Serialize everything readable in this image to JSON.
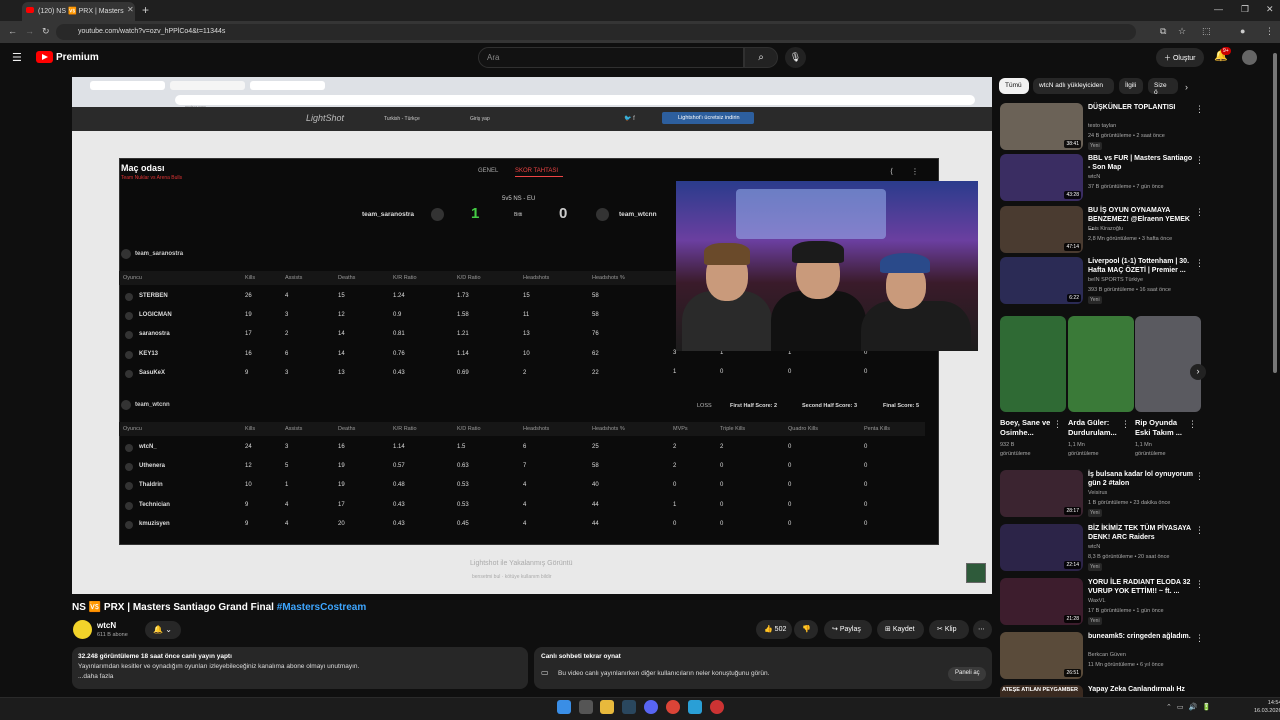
{
  "browser": {
    "tab_title": "(120) NS 🆚 PRX | Masters",
    "url": "youtube.com/watch?v=ozv_hPPlCo4&t=11344s"
  },
  "youtube": {
    "brand": "Premium",
    "search_placeholder": "Ara",
    "create_label": "Oluştur",
    "notif_count": "9+"
  },
  "player": {
    "inner_url": "prntscr.com",
    "lightshot_logo": "LightShot",
    "lightshot_lang": "Turkish - Türkçe",
    "lightshot_login": "Giriş yap",
    "lightshot_download": "Lightshot'ı ücretsiz indirin",
    "caption": "Lightshot ile Yakalanmış Görüntü",
    "caption_sub": "bensetmi bul  ·  kötüye kullanım bildir"
  },
  "scoreboard": {
    "title": "Maç odası",
    "subtitle": "Team Nuklar vs Arena Bulls",
    "tab_general": "GENEL",
    "tab_score": "SKOR TAHTASI",
    "mode": "5v5 NS - EU",
    "team1": "team_saranostra",
    "score1": "1",
    "status": "Bitti",
    "score2": "0",
    "team2": "team_wtcnn",
    "section1": "team_saranostra",
    "section2": "team_wtcnn",
    "loss": "LOSS",
    "first_half": "First Half Score: 2",
    "second_half": "Second Half Score: 3",
    "final": "Final Score: 5",
    "headers": [
      "Oyuncu",
      "Kills",
      "Assists",
      "Deaths",
      "K/R Ratio",
      "K/D Ratio",
      "Headshots",
      "Headshots %"
    ],
    "headers2": [
      "Oyuncu",
      "Kills",
      "Assists",
      "Deaths",
      "K/R Ratio",
      "K/D Ratio",
      "Headshots",
      "Headshots %",
      "MVPs",
      "Triple Kills",
      "Quadro Kills",
      "Penta Kills"
    ],
    "team1_rows": [
      [
        "STERBEN",
        "26",
        "4",
        "15",
        "1.24",
        "1.73",
        "15",
        "58"
      ],
      [
        "LOGICMAN",
        "19",
        "3",
        "12",
        "0.9",
        "1.58",
        "11",
        "58"
      ],
      [
        "saranostra",
        "17",
        "2",
        "14",
        "0.81",
        "1.21",
        "13",
        "76"
      ],
      [
        "KEY13",
        "16",
        "6",
        "14",
        "0.76",
        "1.14",
        "10",
        "62"
      ],
      [
        "SasuKeX",
        "9",
        "3",
        "13",
        "0.43",
        "0.69",
        "2",
        "22"
      ]
    ],
    "team1_visible_extra": [
      [
        "3",
        "1",
        "1",
        "0"
      ],
      [
        "1",
        "0",
        "0",
        "0"
      ]
    ],
    "team2_rows": [
      [
        "wtcN_",
        "24",
        "3",
        "16",
        "1.14",
        "1.5",
        "6",
        "25",
        "2",
        "2",
        "0",
        "0"
      ],
      [
        "Uthenera",
        "12",
        "5",
        "19",
        "0.57",
        "0.63",
        "7",
        "58",
        "2",
        "0",
        "0",
        "0"
      ],
      [
        "Thaldrin",
        "10",
        "1",
        "19",
        "0.48",
        "0.53",
        "4",
        "40",
        "0",
        "0",
        "0",
        "0"
      ],
      [
        "Technician",
        "9",
        "4",
        "17",
        "0.43",
        "0.53",
        "4",
        "44",
        "1",
        "0",
        "0",
        "0"
      ],
      [
        "kmuzisyen",
        "9",
        "4",
        "20",
        "0.43",
        "0.45",
        "4",
        "44",
        "0",
        "0",
        "0",
        "0"
      ]
    ]
  },
  "video": {
    "title_prefix": "NS 🆚 PRX | Masters Santiago Grand Final ",
    "title_tag": "#MastersCostream",
    "channel": "wtcN",
    "subs": "611 B abone",
    "likes": "502",
    "share": "Paylaş",
    "save": "Kaydet",
    "clip": "Klip",
    "desc_line1": "32.248 görüntüleme  18 saat önce canlı yayın yaptı",
    "desc_line2": "Yayınlarımdan kesitler ve oynadığım oyunları izleyebileceğiniz kanalıma abone olmayı unutmayın.",
    "desc_more": "...daha fazla",
    "chat_title": "Canlı sohbeti tekrar oynat",
    "chat_desc": "Bu video canlı yayınlanırken diğer kullanıcıların neler konuştuğunu görün.",
    "chat_button": "Paneli aç"
  },
  "sidebar": {
    "chips": [
      "Tümü",
      "wtcN adlı yükleyiciden",
      "İlgili",
      "Size ö"
    ],
    "videos": [
      {
        "title": "DÜŞKÜNLER TOPLANTISI",
        "channel": "testo taylan",
        "meta": "24 B görüntüleme • 2 saat önce",
        "badge": "Yeni",
        "duration": "38:41",
        "color": "#6b6257"
      },
      {
        "title": "BBL vs FUR | Masters Santiago - Son Map",
        "channel": "wtcN",
        "meta": "37 B görüntüleme • 7 gün önce",
        "badge": "",
        "duration": "43:28",
        "color": "#3a2d62"
      },
      {
        "title": "BU İŞ OYUN OYNAMAYA BENZEMEZ! @Elraenn YEMEK ...",
        "channel": "Enis Kirazoğlu",
        "meta": "2,8 Mn görüntüleme • 3 hafta önce",
        "badge": "",
        "duration": "47:14",
        "color": "#4a3b30"
      },
      {
        "title": "Liverpool (1-1) Tottenham | 30. Hafta MAÇ ÖZETİ | Premier ...",
        "channel": "beIN SPORTS Türkiye",
        "meta": "393 B görüntüleme • 16 saat önce",
        "badge": "Yeni",
        "duration": "6:22",
        "color": "#2b2b55"
      },
      {
        "title": "İş bulsana kadar lol oynuyorum gün 2 #talon",
        "channel": "Veisirus",
        "meta": "1 B görüntüleme • 23 dakika önce",
        "badge": "Yeni",
        "duration": "28:17",
        "color": "#3b2430"
      },
      {
        "title": "BİZ İKİMİZ TEK TÜM PİYASAYA DENK! ARC Raiders",
        "channel": "wtcN",
        "meta": "8,3 B görüntüleme • 20 saat önce",
        "badge": "Yeni",
        "duration": "22:14",
        "color": "#2c2448"
      },
      {
        "title": "YORU İLE RADIANT ELODA 32 VURUP YOK ETTİM!! ~ ft. ...",
        "channel": "WaxVL",
        "meta": "17 B görüntüleme • 1 gün önce",
        "badge": "Yeni",
        "duration": "21:28",
        "color": "#3d1d2d"
      },
      {
        "title": "buneamk5: cringeden ağladım.",
        "channel": "Berkcan Güven",
        "meta": "11 Mn görüntüleme • 6 yıl önce",
        "badge": "",
        "duration": "26:51",
        "color": "#5a4b3a"
      }
    ],
    "shorts": [
      {
        "title": "Boey, Sane ve Osimhe...",
        "meta1": "932 B",
        "meta2": "görüntüleme",
        "color": "#2f6a34"
      },
      {
        "title": "Arda Güler: Durdurulam...",
        "meta1": "1,1 Mn",
        "meta2": "görüntüleme",
        "color": "#3a7a38"
      },
      {
        "title": "Rip Oyunda Eski Takım ...",
        "meta1": "1,1 Mn",
        "meta2": "görüntüleme",
        "color": "#5a5a60"
      }
    ],
    "last_title": "Yapay Zeka Canlandırmalı Hz",
    "last_thumb_text": "ATEŞE ATILAN PEYGAMBER"
  },
  "taskbar": {
    "time": "14:54",
    "date": "16.03.2026"
  }
}
